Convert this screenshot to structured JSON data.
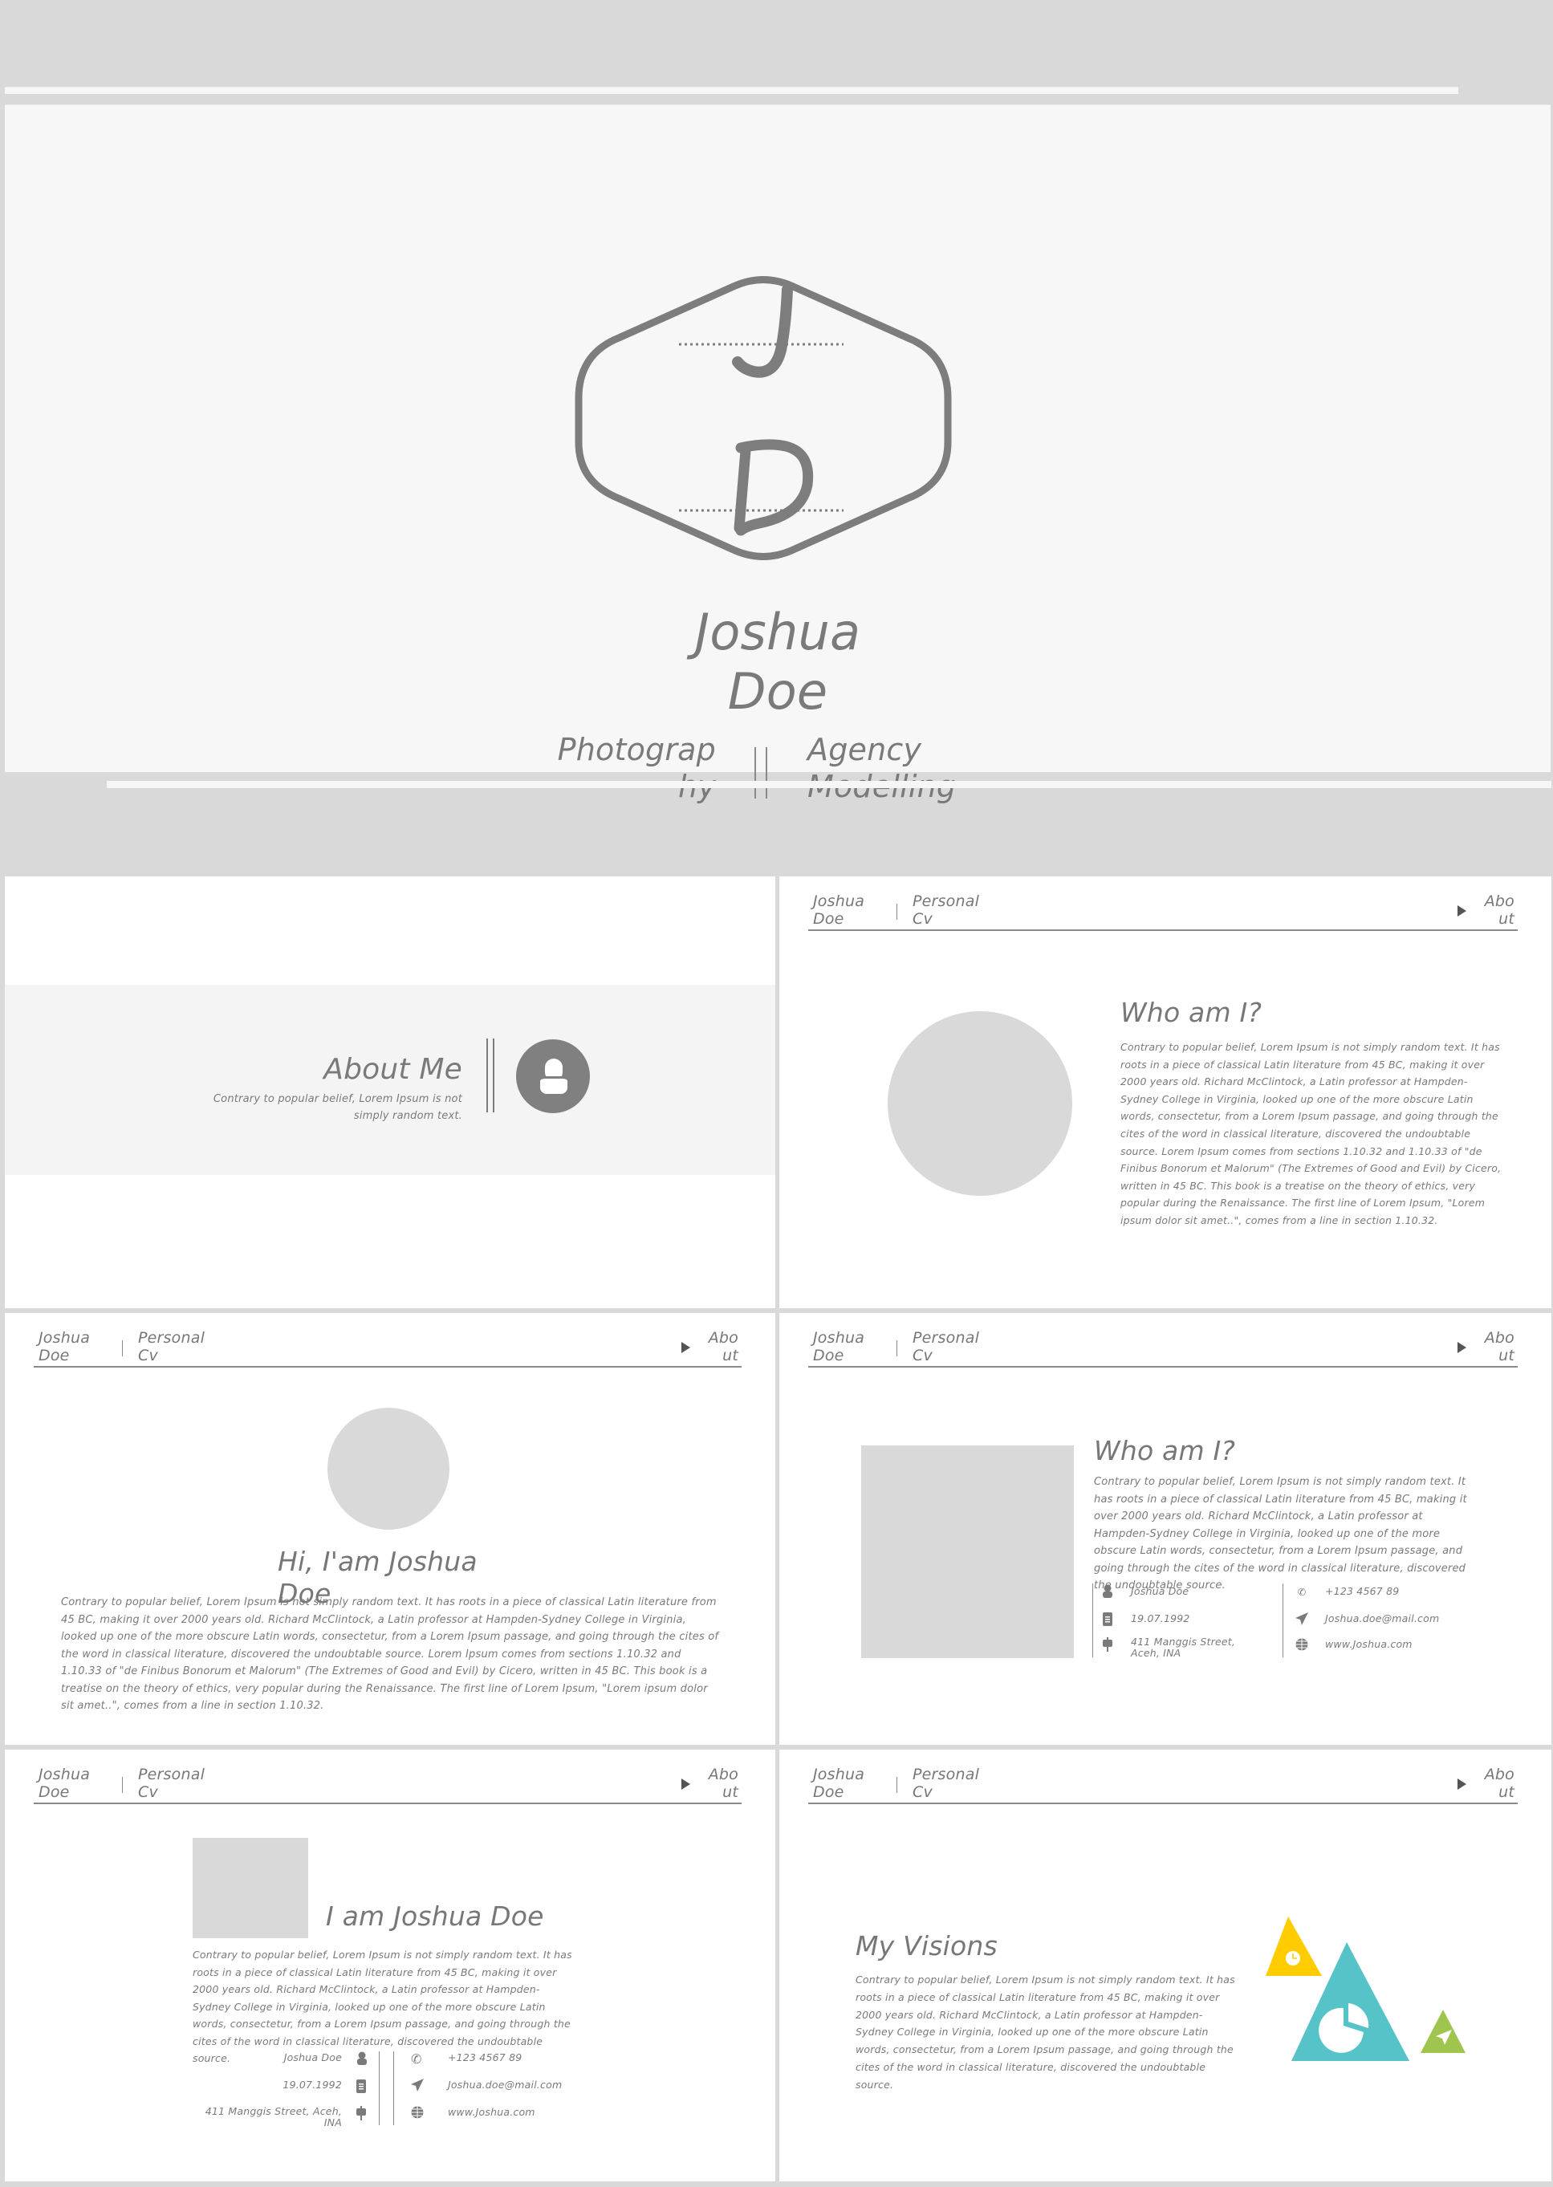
{
  "hero": {
    "monogram": {
      "top": "J",
      "bottom": "D"
    },
    "name": "Joshua Doe",
    "name_line1": "Joshua",
    "name_line2": "Doe",
    "left_tag_line1": "Photograp",
    "left_tag_line2": "hy",
    "right_tag_line1": "Agency",
    "right_tag_line2": "Modelling"
  },
  "header": {
    "name_line1": "Joshua",
    "name_line2": "Doe",
    "section_line1": "Personal",
    "section_line2": "Cv",
    "nav_label": "About",
    "nav_icon": "play-icon"
  },
  "slides": {
    "about": {
      "title": "About Me",
      "subtitle": "Contrary to popular belief, Lorem Ipsum is not simply random text.",
      "icon": "user-icon"
    },
    "who1": {
      "title": "Who am I?",
      "body": "Contrary to popular belief, Lorem Ipsum is not simply random text. It has roots in a piece of classical Latin literature from 45 BC, making it over 2000 years old. Richard McClintock, a Latin professor at Hampden-Sydney College in Virginia, looked up one of the more obscure Latin words, consectetur, from a Lorem Ipsum passage, and going through the cites of the word in classical literature, discovered the undoubtable source. Lorem Ipsum comes from sections 1.10.32 and 1.10.33 of \"de Finibus Bonorum et Malorum\" (The Extremes of Good and Evil) by Cicero, written in 45 BC. This book is a treatise on the theory of ethics, very popular during the Renaissance. The first line of Lorem Ipsum, \"Lorem ipsum dolor sit amet..\", comes from a line in section 1.10.32."
    },
    "hi": {
      "title": "Hi, I'am Joshua Doe",
      "body": "Contrary to popular belief, Lorem Ipsum is not simply random text. It has roots in a piece of classical Latin literature from 45 BC, making it over 2000 years old. Richard McClintock, a Latin professor at Hampden-Sydney College in Virginia, looked up one of the more obscure Latin words, consectetur, from a Lorem Ipsum passage, and going through the cites of the word in classical literature, discovered the undoubtable source. Lorem Ipsum comes from sections 1.10.32 and 1.10.33 of \"de Finibus Bonorum et Malorum\" (The Extremes of Good and Evil) by Cicero, written in 45 BC. This book is a treatise on the theory of ethics, very popular during the Renaissance. The first line of Lorem Ipsum, \"Lorem ipsum dolor sit amet..\", comes from a line in section 1.10.32."
    },
    "who2": {
      "title": "Who am I?",
      "body": "Contrary to popular belief, Lorem Ipsum is not simply random text. It has roots in a piece of classical Latin literature from 45 BC, making it over 2000 years old. Richard McClintock, a Latin professor at Hampden-Sydney College in Virginia, looked up one of the more obscure Latin words, consectetur, from a Lorem Ipsum passage, and going through the cites of the word in classical literature, discovered the undoubtable source."
    },
    "iam": {
      "title": "I am Joshua Doe",
      "body": "Contrary to popular belief, Lorem Ipsum is not simply random text. It has roots in a piece of classical Latin literature from 45 BC, making it over 2000 years old. Richard McClintock, a Latin professor at Hampden-Sydney College in Virginia, looked up one of the more obscure Latin words, consectetur, from a Lorem Ipsum passage, and going through the cites of the word in classical literature, discovered the undoubtable source."
    },
    "visions": {
      "title": "My Visions",
      "body": "Contrary to popular belief, Lorem Ipsum is not simply random text. It has roots in a piece of classical Latin literature from 45 BC, making it over 2000 years old. Richard McClintock, a Latin professor at Hampden-Sydney College in Virginia, looked up one of the more obscure Latin words, consectetur, from a Lorem Ipsum passage, and going through the cites of the word in classical literature, discovered the undoubtable source.",
      "shapes": [
        {
          "color": "#ffcc00",
          "icon": "alarm-clock-icon"
        },
        {
          "color": "#55c3c8",
          "icon": "pie-chart-icon"
        },
        {
          "color": "#9fc54e",
          "icon": "paper-plane-icon"
        }
      ]
    }
  },
  "contact": {
    "name": "Joshua Doe",
    "birthdate": "19.07.1992",
    "address": "411 Manggis Street, Aceh, INA",
    "phone": "+123 4567 89",
    "email": "Joshua.doe@mail.com",
    "website": "www.Joshua.com",
    "icons": {
      "name": "user-icon",
      "birthdate": "calendar-icon",
      "address": "signpost-icon",
      "phone": "phone-icon",
      "email": "paper-plane-icon",
      "website": "globe-icon"
    }
  },
  "colors": {
    "text": "#7a7a7a",
    "placeholder": "#d9d9d9",
    "background": "#d9d9d9",
    "yellow": "#ffcc00",
    "teal": "#55c3c8",
    "green": "#9fc54e"
  }
}
